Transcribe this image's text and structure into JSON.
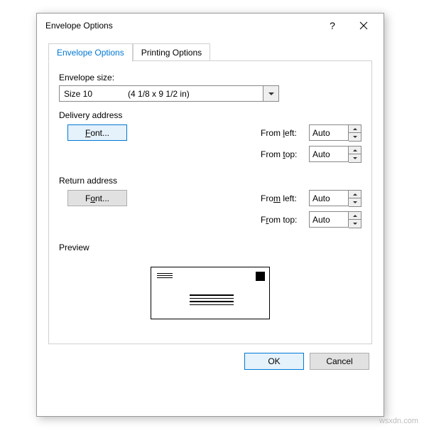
{
  "dialog": {
    "title": "Envelope Options",
    "help_symbol": "?"
  },
  "tabs": {
    "options": "Envelope Options",
    "printing": "Printing Options"
  },
  "envelope_size": {
    "label": "Envelope size:",
    "value_name": "Size 10",
    "value_dims": "(4 1/8 x 9 1/2 in)"
  },
  "delivery": {
    "label": "Delivery address",
    "font_btn": "Font...",
    "from_left_label": "From left:",
    "from_left_value": "Auto",
    "from_top_label": "From top:",
    "from_top_value": "Auto"
  },
  "return": {
    "label": "Return address",
    "font_btn": "Font...",
    "from_left_label": "From left:",
    "from_left_value": "Auto",
    "from_top_label": "From top:",
    "from_top_value": "Auto"
  },
  "preview": {
    "label": "Preview"
  },
  "footer": {
    "ok": "OK",
    "cancel": "Cancel"
  },
  "watermark": "wsxdn.com"
}
